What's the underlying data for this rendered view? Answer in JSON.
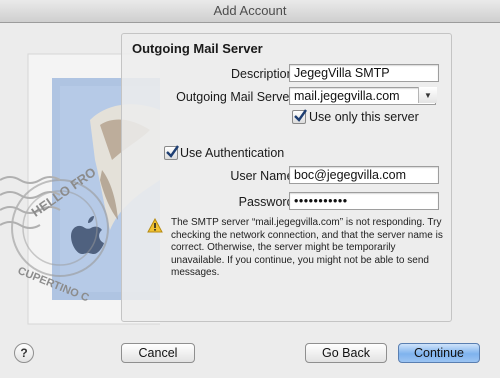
{
  "window": {
    "title": "Add Account"
  },
  "stamp": {
    "postmark_top": "HELLO FRO",
    "postmark_bottom": "CUPERTINO C"
  },
  "panel": {
    "title": "Outgoing Mail Server",
    "description": {
      "label": "Description:",
      "value": "JegegVilla SMTP"
    },
    "server": {
      "label": "Outgoing Mail Server:",
      "value": "mail.jegegvilla.com"
    },
    "use_only": {
      "label": "Use only this server",
      "checked": true
    },
    "use_auth": {
      "label": "Use Authentication",
      "checked": true
    },
    "username": {
      "label": "User Name:",
      "value": "boc@jegegvilla.com"
    },
    "password": {
      "label": "Password:",
      "value": "•••••••••••"
    },
    "warning": {
      "icon": "warning-icon",
      "text": "The SMTP server “mail.jegegvilla.com” is not responding. Try checking the network connection, and that the server name is correct. Otherwise, the server might be temporarily unavailable. If you continue, you might not be able to send messages."
    }
  },
  "buttons": {
    "help": "?",
    "cancel": "Cancel",
    "go_back": "Go Back",
    "continue": "Continue"
  },
  "colors": {
    "primary_button": "#7fb3ee",
    "check_mark": "#1f3f73"
  }
}
